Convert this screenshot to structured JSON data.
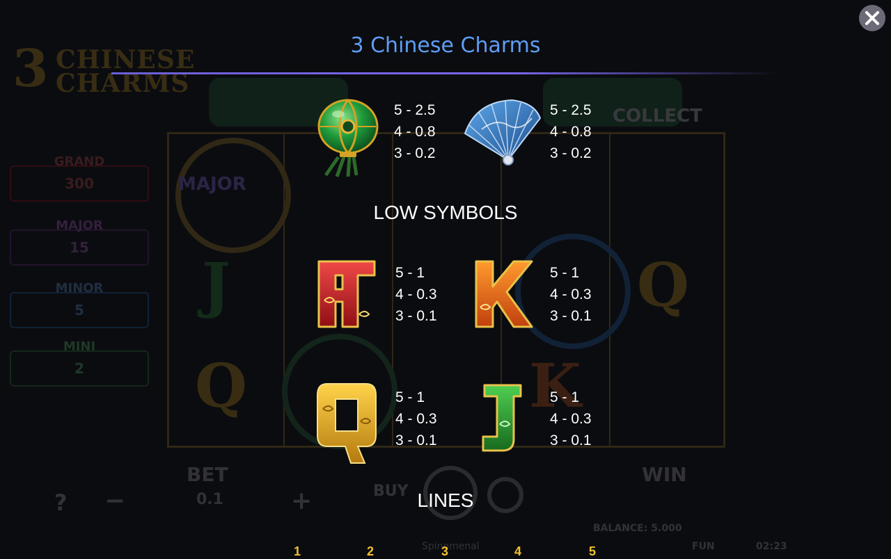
{
  "title": "3 Chinese Charms",
  "close_icon": "close-icon",
  "sections": {
    "low_symbols_heading": "LOW SYMBOLS",
    "lines_heading": "LINES"
  },
  "high_symbols": [
    {
      "name": "green-lantern-icon",
      "payouts": [
        "5 - 2.5",
        "4 - 0.8",
        "3 - 0.2"
      ]
    },
    {
      "name": "blue-fan-icon",
      "payouts": [
        "5 - 2.5",
        "4 - 0.8",
        "3 - 0.2"
      ]
    }
  ],
  "low_symbols": [
    {
      "name": "letter-a-icon",
      "payouts": [
        "5 - 1",
        "4 - 0.3",
        "3 - 0.1"
      ]
    },
    {
      "name": "letter-k-icon",
      "payouts": [
        "5 - 1",
        "4 - 0.3",
        "3 - 0.1"
      ]
    },
    {
      "name": "letter-q-icon",
      "payouts": [
        "5 - 1",
        "4 - 0.3",
        "3 - 0.1"
      ]
    },
    {
      "name": "letter-j-icon",
      "payouts": [
        "5 - 1",
        "4 - 0.3",
        "3 - 0.1"
      ]
    }
  ],
  "line_numbers": [
    "1",
    "2",
    "3",
    "4",
    "5"
  ],
  "background_game": {
    "logo": {
      "number": "3",
      "line1": "CHINESE",
      "line2": "CHARMS"
    },
    "jackpots": [
      {
        "label": "GRAND",
        "value": "300",
        "color": "#b0171b"
      },
      {
        "label": "MAJOR",
        "value": "15",
        "color": "#7b2a8f"
      },
      {
        "label": "MINOR",
        "value": "5",
        "color": "#2a6fc2"
      },
      {
        "label": "MINI",
        "value": "2",
        "color": "#2f8d3a"
      }
    ],
    "bet_label": "BET",
    "bet_value": "0.1",
    "win_label": "WIN",
    "buy_label": "BUY",
    "help_symbol": "?",
    "minus_symbol": "−",
    "plus_symbol": "+",
    "balance": "BALANCE: 5.000",
    "mode": "FUN",
    "clock": "02:23",
    "game_name": "Spinomenal",
    "collect_label": "COLLECT",
    "major_reel_label": "MAJOR"
  },
  "colors": {
    "title": "#5f9df5",
    "accent_line": "#7a68f0",
    "line_numbers": "#f2c22a"
  }
}
